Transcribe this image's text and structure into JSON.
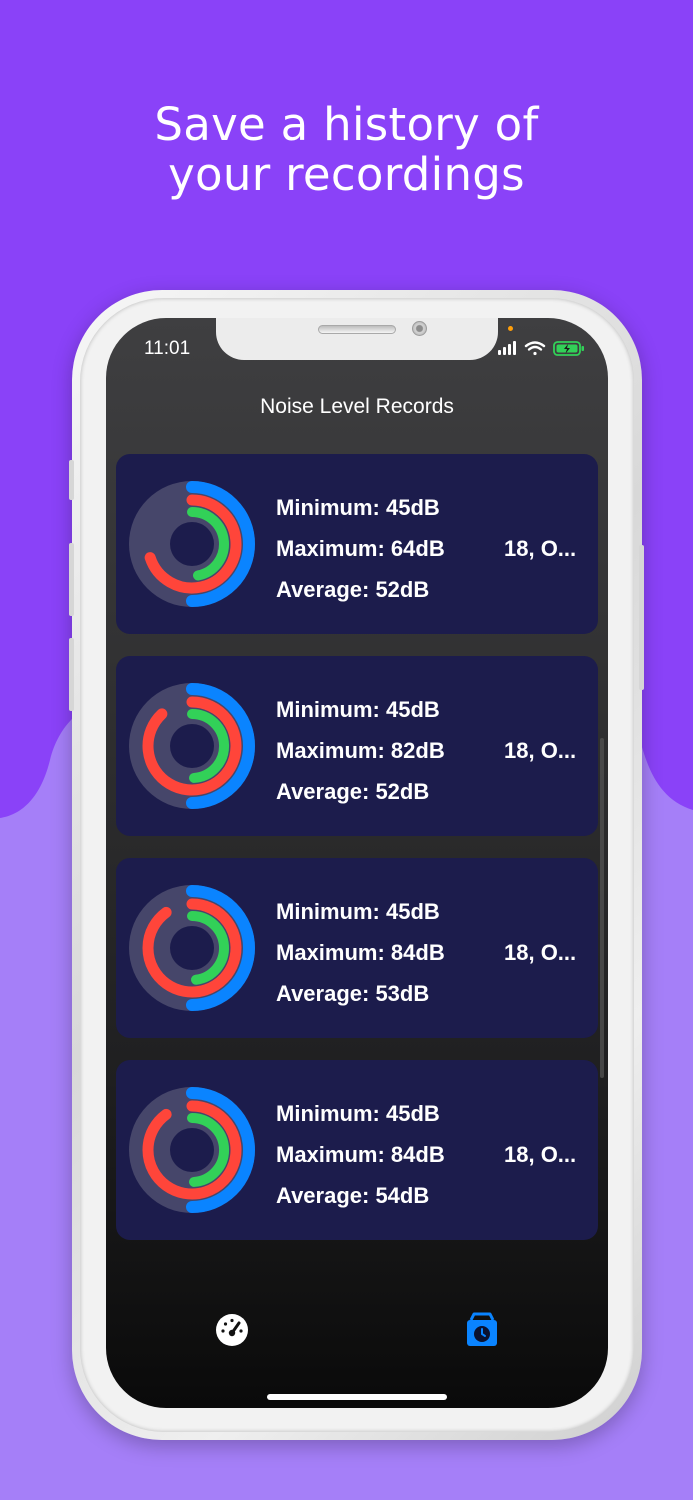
{
  "promo": {
    "headline_line1": "Save a history of",
    "headline_line2": "your recordings"
  },
  "colors": {
    "bg_top": "#8a42f8",
    "bg_bottom": "#a57ff8",
    "card": "#1c1c4c",
    "ring_blue": "#0a84ff",
    "ring_red": "#ff453a",
    "ring_green": "#32d158",
    "ring_track": "#46466a",
    "tab_active": "#0a84ff",
    "battery": "#32d158"
  },
  "status_bar": {
    "time": "11:01"
  },
  "nav": {
    "title": "Noise Level Records"
  },
  "records": [
    {
      "min_label": "Minimum: 45dB",
      "max_label": "Maximum: 64dB",
      "avg_label": "Average: 52dB",
      "date": "18, O...",
      "rings": {
        "blue": 0.5,
        "red": 0.7,
        "green": 0.47
      }
    },
    {
      "min_label": "Minimum: 45dB",
      "max_label": "Maximum: 82dB",
      "avg_label": "Average: 52dB",
      "date": "18, O...",
      "rings": {
        "blue": 0.5,
        "red": 0.88,
        "green": 0.49
      }
    },
    {
      "min_label": "Minimum: 45dB",
      "max_label": "Maximum: 84dB",
      "avg_label": "Average: 53dB",
      "date": "18, O...",
      "rings": {
        "blue": 0.5,
        "red": 0.9,
        "green": 0.48
      }
    },
    {
      "min_label": "Minimum: 45dB",
      "max_label": "Maximum: 84dB",
      "avg_label": "Average: 54dB",
      "date": "18, O...",
      "rings": {
        "blue": 0.5,
        "red": 0.9,
        "green": 0.49
      }
    }
  ],
  "tab_bar": {
    "items": [
      {
        "icon": "gauge-icon",
        "active": false
      },
      {
        "icon": "history-icon",
        "active": true
      }
    ]
  }
}
